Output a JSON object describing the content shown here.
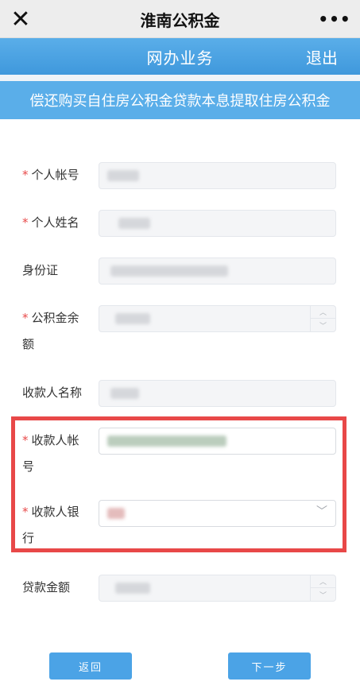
{
  "titlebar": {
    "close_icon": "✕",
    "title": "淮南公积金",
    "more_icon": "•••"
  },
  "navbar": {
    "title": "网办业务",
    "logout_label": "退出"
  },
  "banner": {
    "text": "偿还购买自住房公积金贷款本息提取住房公积金"
  },
  "form": {
    "personal_account_label": "个人帐号",
    "personal_name_label": "个人姓名",
    "id_card_label": "身份证",
    "balance_label_line1": "公积金余",
    "balance_label_line2": "额",
    "payee_name_label": "收款人名称",
    "payee_account_label_line1": "收款人帐",
    "payee_account_label_line2": "号",
    "payee_bank_label_line1": "收款人银",
    "payee_bank_label_line2": "行",
    "loan_amount_label": "贷款金额",
    "required_mark": "*"
  },
  "buttons": {
    "back_label": "返回",
    "next_label": "下一步"
  },
  "colors": {
    "brand_blue": "#5aaee9",
    "required_red": "#e84a4a",
    "highlight_red": "#e84848"
  }
}
